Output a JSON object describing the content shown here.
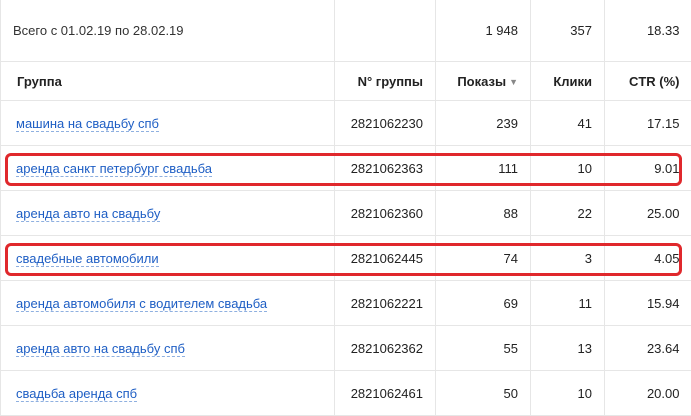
{
  "total": {
    "label": "Всего с 01.02.19 по 28.02.19",
    "impressions": "1 948",
    "clicks": "357",
    "ctr": "18.33"
  },
  "header": {
    "group": "Группа",
    "group_no": "N° группы",
    "impressions": "Показы",
    "clicks": "Клики",
    "ctr": "CTR (%)",
    "sort_icon": "sort-desc-triangle-icon"
  },
  "rows": [
    {
      "name": "машина на свадьбу спб",
      "id": "2821062230",
      "impressions": "239",
      "clicks": "41",
      "ctr": "17.15",
      "highlighted": false
    },
    {
      "name": "аренда санкт петербург свадьба",
      "id": "2821062363",
      "impressions": "111",
      "clicks": "10",
      "ctr": "9.01",
      "highlighted": true
    },
    {
      "name": "аренда авто на свадьбу",
      "id": "2821062360",
      "impressions": "88",
      "clicks": "22",
      "ctr": "25.00",
      "highlighted": false
    },
    {
      "name": "свадебные автомобили",
      "id": "2821062445",
      "impressions": "74",
      "clicks": "3",
      "ctr": "4.05",
      "highlighted": true
    },
    {
      "name": "аренда автомобиля с водителем свадьба",
      "id": "2821062221",
      "impressions": "69",
      "clicks": "11",
      "ctr": "15.94",
      "highlighted": false
    },
    {
      "name": "аренда авто на свадьбу спб",
      "id": "2821062362",
      "impressions": "55",
      "clicks": "13",
      "ctr": "23.64",
      "highlighted": false
    },
    {
      "name": "свадьба аренда спб",
      "id": "2821062461",
      "impressions": "50",
      "clicks": "10",
      "ctr": "20.00",
      "highlighted": false
    }
  ],
  "colors": {
    "link": "#1e5ec4",
    "highlight_border": "#e0282c",
    "grid": "#e6e6e6"
  }
}
